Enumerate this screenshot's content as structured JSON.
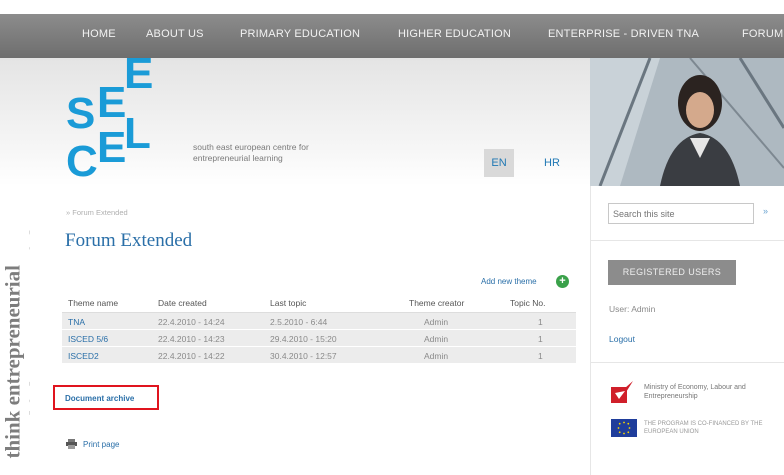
{
  "nav": {
    "items": [
      {
        "label": "HOME"
      },
      {
        "label": "ABOUT US"
      },
      {
        "label": "PRIMARY EDUCATION"
      },
      {
        "label": "HIGHER EDUCATION"
      },
      {
        "label": "ENTERPRISE - DRIVEN TNA"
      },
      {
        "label": "FORUM"
      }
    ]
  },
  "header": {
    "logo_text": "SEECEL",
    "tagline": "south east european centre for entrepreneurial learning",
    "languages": [
      {
        "code": "EN",
        "active": true
      },
      {
        "code": "HR",
        "active": false
      }
    ]
  },
  "side_banner": {
    "text": "think entrepreneurial"
  },
  "main": {
    "breadcrumb": "» Forum Extended",
    "title": "Forum Extended",
    "add_theme": "Add new theme",
    "table": {
      "headers": [
        "Theme name",
        "Date created",
        "Last topic",
        "Theme creator",
        "Topic No."
      ],
      "rows": [
        [
          "TNA",
          "22.4.2010 - 14:24",
          "2.5.2010 - 6:44",
          "Admin",
          "1"
        ],
        [
          "ISCED 5/6",
          "22.4.2010 - 14:23",
          "29.4.2010 - 15:20",
          "Admin",
          "1"
        ],
        [
          "ISCED2",
          "22.4.2010 - 14:22",
          "30.4.2010 - 12:57",
          "Admin",
          "1"
        ]
      ]
    },
    "document_archive": "Document archive",
    "print_page": "Print page"
  },
  "sidebar": {
    "search_placeholder": "Search this site",
    "search_go": "»",
    "registered_users": "REGISTERED USERS",
    "user": "User: Admin",
    "logout": "Logout",
    "ministry": "Ministry of Economy, Labour and Entrepreneurship",
    "eu": "THE PROGRAM IS CO-FINANCED BY THE EUROPEAN UNION"
  },
  "colors": {
    "accent": "#2a6fa8",
    "highlight_box": "#e0141e",
    "nav_bg": "#7d7d7d",
    "logo_blue": "#1a9bd7"
  }
}
